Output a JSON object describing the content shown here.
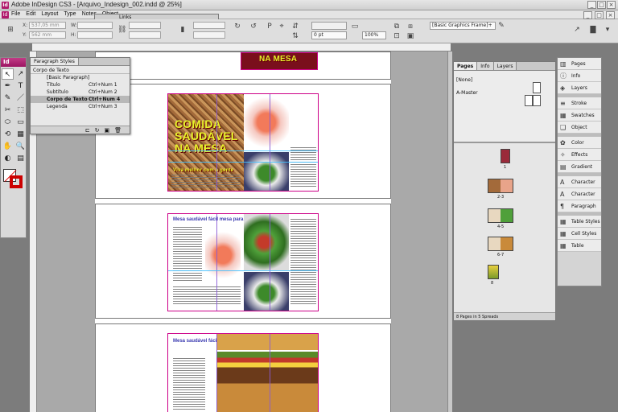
{
  "window": {
    "title": "Adobe InDesign CS3 - [Arquivo_Indesign_002.indd @ 25%]",
    "app_icon": "Id",
    "controls": [
      "_",
      "□",
      "×"
    ]
  },
  "menu": [
    "File",
    "Edit",
    "Layout",
    "Type",
    "Notes",
    "Object"
  ],
  "controlbar": {
    "x_label": "X:",
    "x_value": "537,05 mm",
    "y_label": "Y:",
    "y_value": "562 mm",
    "w_label": "W:",
    "h_label": "H:",
    "zoom_value": "100%",
    "stroke_value": "0 pt",
    "object_style": "[Basic Graphics Frame]+"
  },
  "tools": {
    "header": "Id",
    "items": [
      "↖",
      "↗",
      "✒",
      "T",
      "✎",
      "／",
      "✂",
      "⬚",
      "⬭",
      "▭",
      "⟲",
      "▦",
      "✋",
      "🔍",
      "◐",
      "▤"
    ]
  },
  "links_panel": {
    "title": "Links"
  },
  "paragraph_styles": {
    "tab": "Paragraph Styles",
    "current": "Corpo de Texto",
    "rows": [
      {
        "name": "[Basic Paragraph]",
        "shortcut": ""
      },
      {
        "name": "Título",
        "shortcut": "Ctrl+Num 1"
      },
      {
        "name": "Subtítulo",
        "shortcut": "Ctrl+Num 2"
      },
      {
        "name": "Corpo de Texto",
        "shortcut": "Ctrl+Num 4"
      },
      {
        "name": "Legenda",
        "shortcut": "Ctrl+Num 3"
      }
    ],
    "footer_icons": [
      "⊏",
      "↻",
      "▣",
      "🗑"
    ]
  },
  "document": {
    "top_banner": "NA MESA",
    "cover_headline": [
      "COMIDA",
      "SAUDÁVEL",
      "NA MESA"
    ],
    "cover_footer": "Viva melhor com a gente",
    "spread2_head": "Mesa saudável fácil mesa para ser",
    "spread3_head": "Mesa saudável fácil demais"
  },
  "pages_panel": {
    "tabs": [
      "Pages",
      "Info",
      "Layers"
    ],
    "masters": [
      "[None]",
      "A-Master"
    ],
    "spread_labels": [
      "1",
      "2-3",
      "4-5",
      "6-7",
      "8"
    ],
    "footer": "8 Pages in 5 Spreads"
  },
  "dock": {
    "groups": [
      [
        {
          "label": "Pages",
          "icon": "▥"
        },
        {
          "label": "Info",
          "icon": "ⓘ"
        },
        {
          "label": "Layers",
          "icon": "◈"
        }
      ],
      [
        {
          "label": "Stroke",
          "icon": "≡"
        },
        {
          "label": "Swatches",
          "icon": "▦"
        },
        {
          "label": "Object Styles",
          "icon": "❑"
        }
      ],
      [
        {
          "label": "Color",
          "icon": "✿"
        },
        {
          "label": "Effects",
          "icon": "✧"
        },
        {
          "label": "Gradient",
          "icon": "▤"
        }
      ],
      [
        {
          "label": "Character",
          "icon": "A"
        },
        {
          "label": "Character Styles",
          "icon": "A"
        },
        {
          "label": "Paragraph",
          "icon": "¶"
        }
      ],
      [
        {
          "label": "Table Styles",
          "icon": "▦"
        },
        {
          "label": "Cell Styles",
          "icon": "▦"
        },
        {
          "label": "Table",
          "icon": "▦"
        }
      ]
    ]
  }
}
